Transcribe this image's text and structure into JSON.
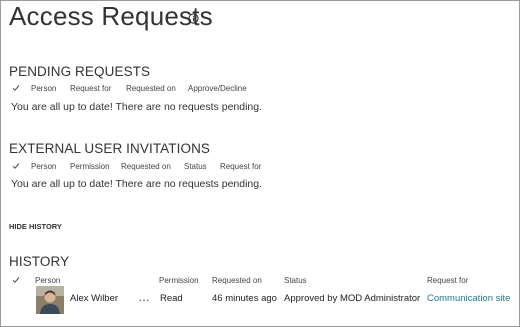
{
  "page": {
    "title": "Access Requests"
  },
  "pending": {
    "title": "PENDING REQUESTS",
    "columns": [
      "Person",
      "Request for",
      "Requested on",
      "Approve/Decline"
    ],
    "empty_message": "You are all up to date! There are no requests pending."
  },
  "external": {
    "title": "EXTERNAL USER INVITATIONS",
    "columns": [
      "Person",
      "Permission",
      "Requested on",
      "Status",
      "Request for"
    ],
    "empty_message": "You are all up to date! There are no requests pending."
  },
  "hide_history_label": "HIDE HISTORY",
  "history": {
    "title": "HISTORY",
    "columns": [
      "Person",
      "Permission",
      "Requested on",
      "Status",
      "Request for"
    ],
    "rows": [
      {
        "person": "Alex Wilber",
        "more": "…",
        "permission": "Read",
        "requested_on": "46 minutes ago",
        "status": "Approved by MOD Administrator",
        "request_for": "Communication site"
      }
    ]
  },
  "colors": {
    "link": "#1f7a8c",
    "text": "#333333",
    "border": "#9a9a9a"
  },
  "icons": {
    "info": "info-icon",
    "check": "checkmark-icon",
    "more": "ellipsis-icon"
  }
}
